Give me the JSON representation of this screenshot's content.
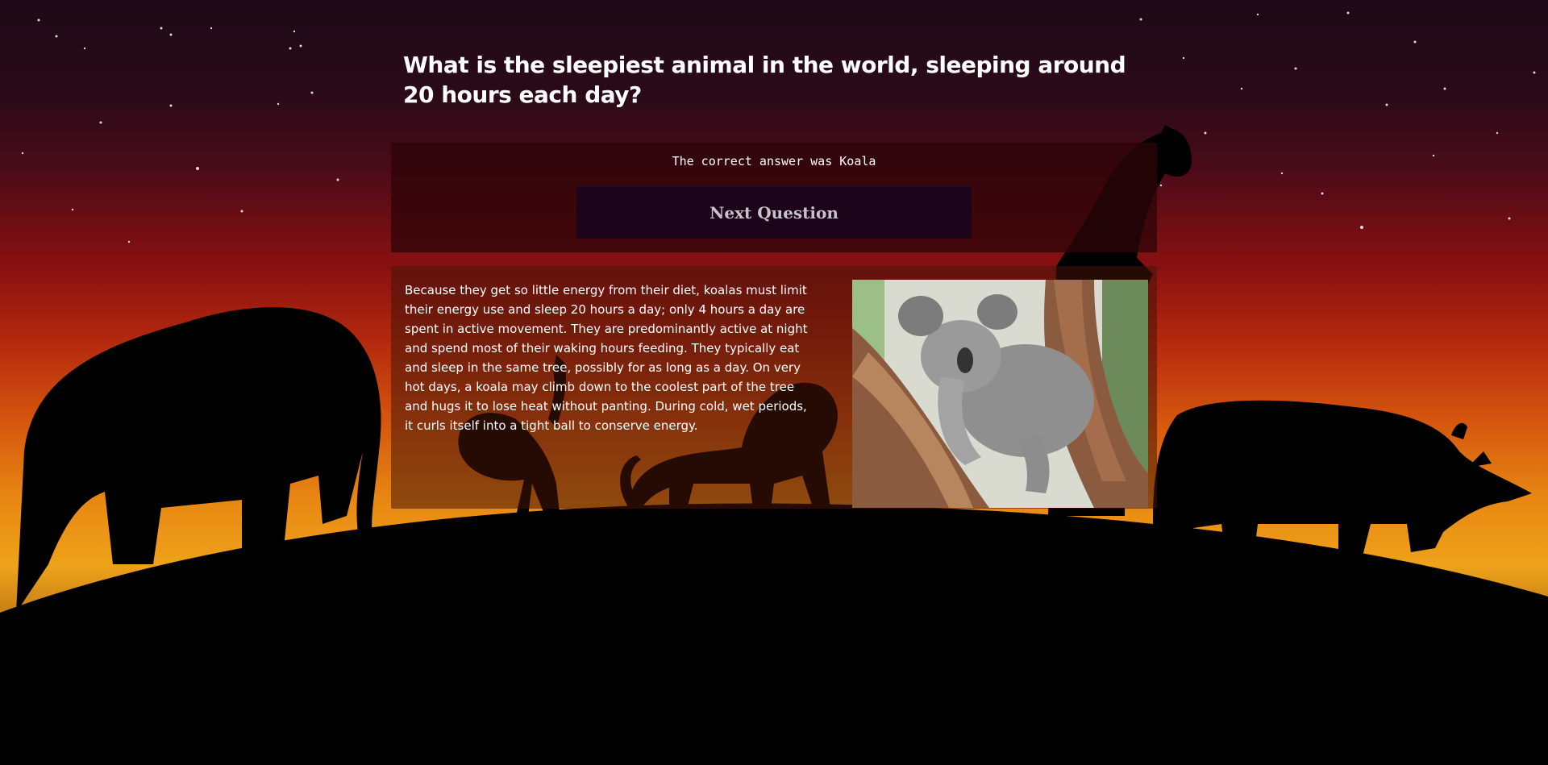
{
  "quiz": {
    "question": "What is the sleepiest animal in the world, sleeping around 20 hours each day?",
    "result_text": "The correct answer was Koala",
    "next_button_label": "Next Question",
    "fact_text": "Because they get so little energy from their diet, koalas must limit their energy use and sleep 20 hours a day; only 4 hours a day are spent in active movement. They are predominantly active at night and spend most of their waking hours feeding. They typically eat and sleep in the same tree, possibly for as long as a day. On very hot days, a koala may climb down to the coolest part of the tree and hugs it to lose heat without panting. During cold, wet periods, it curls itself into a tight ball to conserve energy."
  },
  "colors": {
    "panel_dark": "#2d0408",
    "button_bg": "#1c041b",
    "button_text": "#c9c2c8",
    "sky_top": "#1e0916",
    "sky_red": "#8a1010",
    "sky_orange": "#e98a13"
  },
  "images": {
    "background": "night-savanna-silhouettes-background",
    "photo": "sleeping-koala-photo"
  }
}
